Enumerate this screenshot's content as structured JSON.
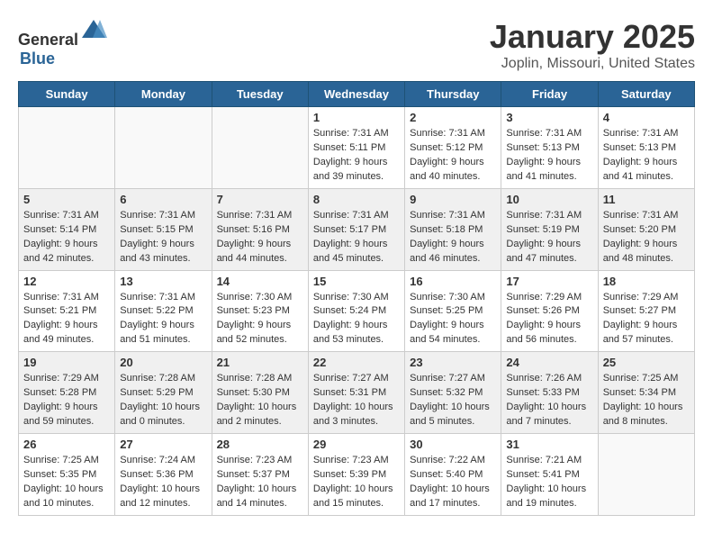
{
  "header": {
    "logo_general": "General",
    "logo_blue": "Blue",
    "month": "January 2025",
    "location": "Joplin, Missouri, United States"
  },
  "days_of_week": [
    "Sunday",
    "Monday",
    "Tuesday",
    "Wednesday",
    "Thursday",
    "Friday",
    "Saturday"
  ],
  "weeks": [
    {
      "shaded": false,
      "days": [
        {
          "num": "",
          "info": ""
        },
        {
          "num": "",
          "info": ""
        },
        {
          "num": "",
          "info": ""
        },
        {
          "num": "1",
          "info": "Sunrise: 7:31 AM\nSunset: 5:11 PM\nDaylight: 9 hours\nand 39 minutes."
        },
        {
          "num": "2",
          "info": "Sunrise: 7:31 AM\nSunset: 5:12 PM\nDaylight: 9 hours\nand 40 minutes."
        },
        {
          "num": "3",
          "info": "Sunrise: 7:31 AM\nSunset: 5:13 PM\nDaylight: 9 hours\nand 41 minutes."
        },
        {
          "num": "4",
          "info": "Sunrise: 7:31 AM\nSunset: 5:13 PM\nDaylight: 9 hours\nand 41 minutes."
        }
      ]
    },
    {
      "shaded": true,
      "days": [
        {
          "num": "5",
          "info": "Sunrise: 7:31 AM\nSunset: 5:14 PM\nDaylight: 9 hours\nand 42 minutes."
        },
        {
          "num": "6",
          "info": "Sunrise: 7:31 AM\nSunset: 5:15 PM\nDaylight: 9 hours\nand 43 minutes."
        },
        {
          "num": "7",
          "info": "Sunrise: 7:31 AM\nSunset: 5:16 PM\nDaylight: 9 hours\nand 44 minutes."
        },
        {
          "num": "8",
          "info": "Sunrise: 7:31 AM\nSunset: 5:17 PM\nDaylight: 9 hours\nand 45 minutes."
        },
        {
          "num": "9",
          "info": "Sunrise: 7:31 AM\nSunset: 5:18 PM\nDaylight: 9 hours\nand 46 minutes."
        },
        {
          "num": "10",
          "info": "Sunrise: 7:31 AM\nSunset: 5:19 PM\nDaylight: 9 hours\nand 47 minutes."
        },
        {
          "num": "11",
          "info": "Sunrise: 7:31 AM\nSunset: 5:20 PM\nDaylight: 9 hours\nand 48 minutes."
        }
      ]
    },
    {
      "shaded": false,
      "days": [
        {
          "num": "12",
          "info": "Sunrise: 7:31 AM\nSunset: 5:21 PM\nDaylight: 9 hours\nand 49 minutes."
        },
        {
          "num": "13",
          "info": "Sunrise: 7:31 AM\nSunset: 5:22 PM\nDaylight: 9 hours\nand 51 minutes."
        },
        {
          "num": "14",
          "info": "Sunrise: 7:30 AM\nSunset: 5:23 PM\nDaylight: 9 hours\nand 52 minutes."
        },
        {
          "num": "15",
          "info": "Sunrise: 7:30 AM\nSunset: 5:24 PM\nDaylight: 9 hours\nand 53 minutes."
        },
        {
          "num": "16",
          "info": "Sunrise: 7:30 AM\nSunset: 5:25 PM\nDaylight: 9 hours\nand 54 minutes."
        },
        {
          "num": "17",
          "info": "Sunrise: 7:29 AM\nSunset: 5:26 PM\nDaylight: 9 hours\nand 56 minutes."
        },
        {
          "num": "18",
          "info": "Sunrise: 7:29 AM\nSunset: 5:27 PM\nDaylight: 9 hours\nand 57 minutes."
        }
      ]
    },
    {
      "shaded": true,
      "days": [
        {
          "num": "19",
          "info": "Sunrise: 7:29 AM\nSunset: 5:28 PM\nDaylight: 9 hours\nand 59 minutes."
        },
        {
          "num": "20",
          "info": "Sunrise: 7:28 AM\nSunset: 5:29 PM\nDaylight: 10 hours\nand 0 minutes."
        },
        {
          "num": "21",
          "info": "Sunrise: 7:28 AM\nSunset: 5:30 PM\nDaylight: 10 hours\nand 2 minutes."
        },
        {
          "num": "22",
          "info": "Sunrise: 7:27 AM\nSunset: 5:31 PM\nDaylight: 10 hours\nand 3 minutes."
        },
        {
          "num": "23",
          "info": "Sunrise: 7:27 AM\nSunset: 5:32 PM\nDaylight: 10 hours\nand 5 minutes."
        },
        {
          "num": "24",
          "info": "Sunrise: 7:26 AM\nSunset: 5:33 PM\nDaylight: 10 hours\nand 7 minutes."
        },
        {
          "num": "25",
          "info": "Sunrise: 7:25 AM\nSunset: 5:34 PM\nDaylight: 10 hours\nand 8 minutes."
        }
      ]
    },
    {
      "shaded": false,
      "days": [
        {
          "num": "26",
          "info": "Sunrise: 7:25 AM\nSunset: 5:35 PM\nDaylight: 10 hours\nand 10 minutes."
        },
        {
          "num": "27",
          "info": "Sunrise: 7:24 AM\nSunset: 5:36 PM\nDaylight: 10 hours\nand 12 minutes."
        },
        {
          "num": "28",
          "info": "Sunrise: 7:23 AM\nSunset: 5:37 PM\nDaylight: 10 hours\nand 14 minutes."
        },
        {
          "num": "29",
          "info": "Sunrise: 7:23 AM\nSunset: 5:39 PM\nDaylight: 10 hours\nand 15 minutes."
        },
        {
          "num": "30",
          "info": "Sunrise: 7:22 AM\nSunset: 5:40 PM\nDaylight: 10 hours\nand 17 minutes."
        },
        {
          "num": "31",
          "info": "Sunrise: 7:21 AM\nSunset: 5:41 PM\nDaylight: 10 hours\nand 19 minutes."
        },
        {
          "num": "",
          "info": ""
        }
      ]
    }
  ]
}
